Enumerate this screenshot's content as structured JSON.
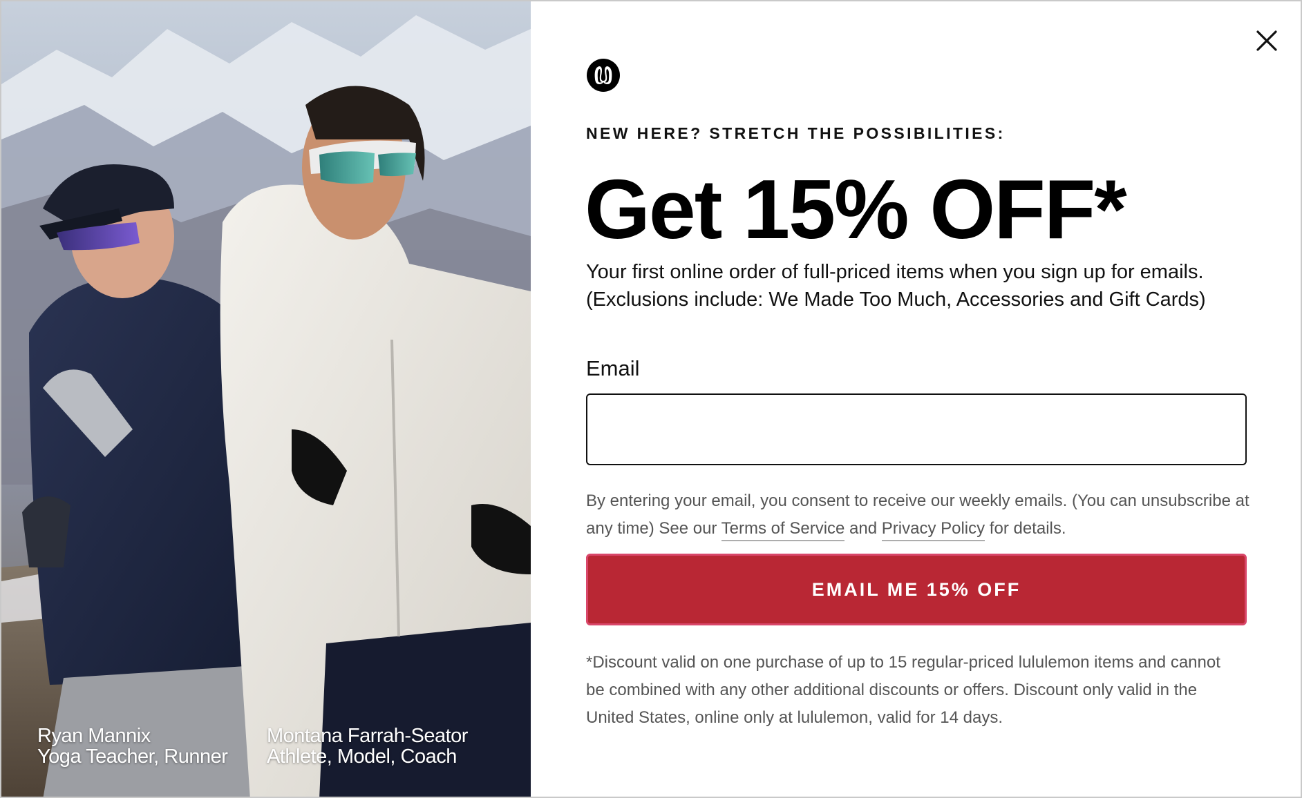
{
  "photo": {
    "captions": [
      {
        "name": "Ryan Mannix",
        "role": "Yoga Teacher, Runner"
      },
      {
        "name": "Montana Farrah-Seator",
        "role": "Athlete, Model, Coach"
      }
    ]
  },
  "popup": {
    "close_icon": "close-icon",
    "logo_icon": "lululemon-logo-icon",
    "eyebrow": "NEW HERE? STRETCH THE POSSIBILITIES:",
    "headline": "Get 15% OFF*",
    "subcopy_line1": "Your first online order of full-priced items when you sign up for emails.",
    "subcopy_line2": "(Exclusions include: We Made Too Much, Accessories and Gift Cards)",
    "email_label": "Email",
    "email_value": "",
    "consent_prefix": "By entering your email, you consent to receive our weekly emails. (You can unsubscribe at any time) See our ",
    "terms_link": "Terms of Service",
    "consent_and": " and ",
    "privacy_link": "Privacy Policy",
    "consent_suffix": " for details.",
    "cta_label": "EMAIL ME 15% OFF",
    "disclaimer_line1": "*Discount valid on one purchase of up to 15 regular-priced lululemon items and cannot",
    "disclaimer_line2": "be combined with any other additional discounts or offers. Discount only valid in the",
    "disclaimer_line3": "United States, online only at lululemon, valid for 14 days."
  },
  "colors": {
    "cta_background": "#b92734",
    "cta_border": "#d9476a",
    "text_primary": "#111111",
    "text_secondary": "#555555"
  }
}
